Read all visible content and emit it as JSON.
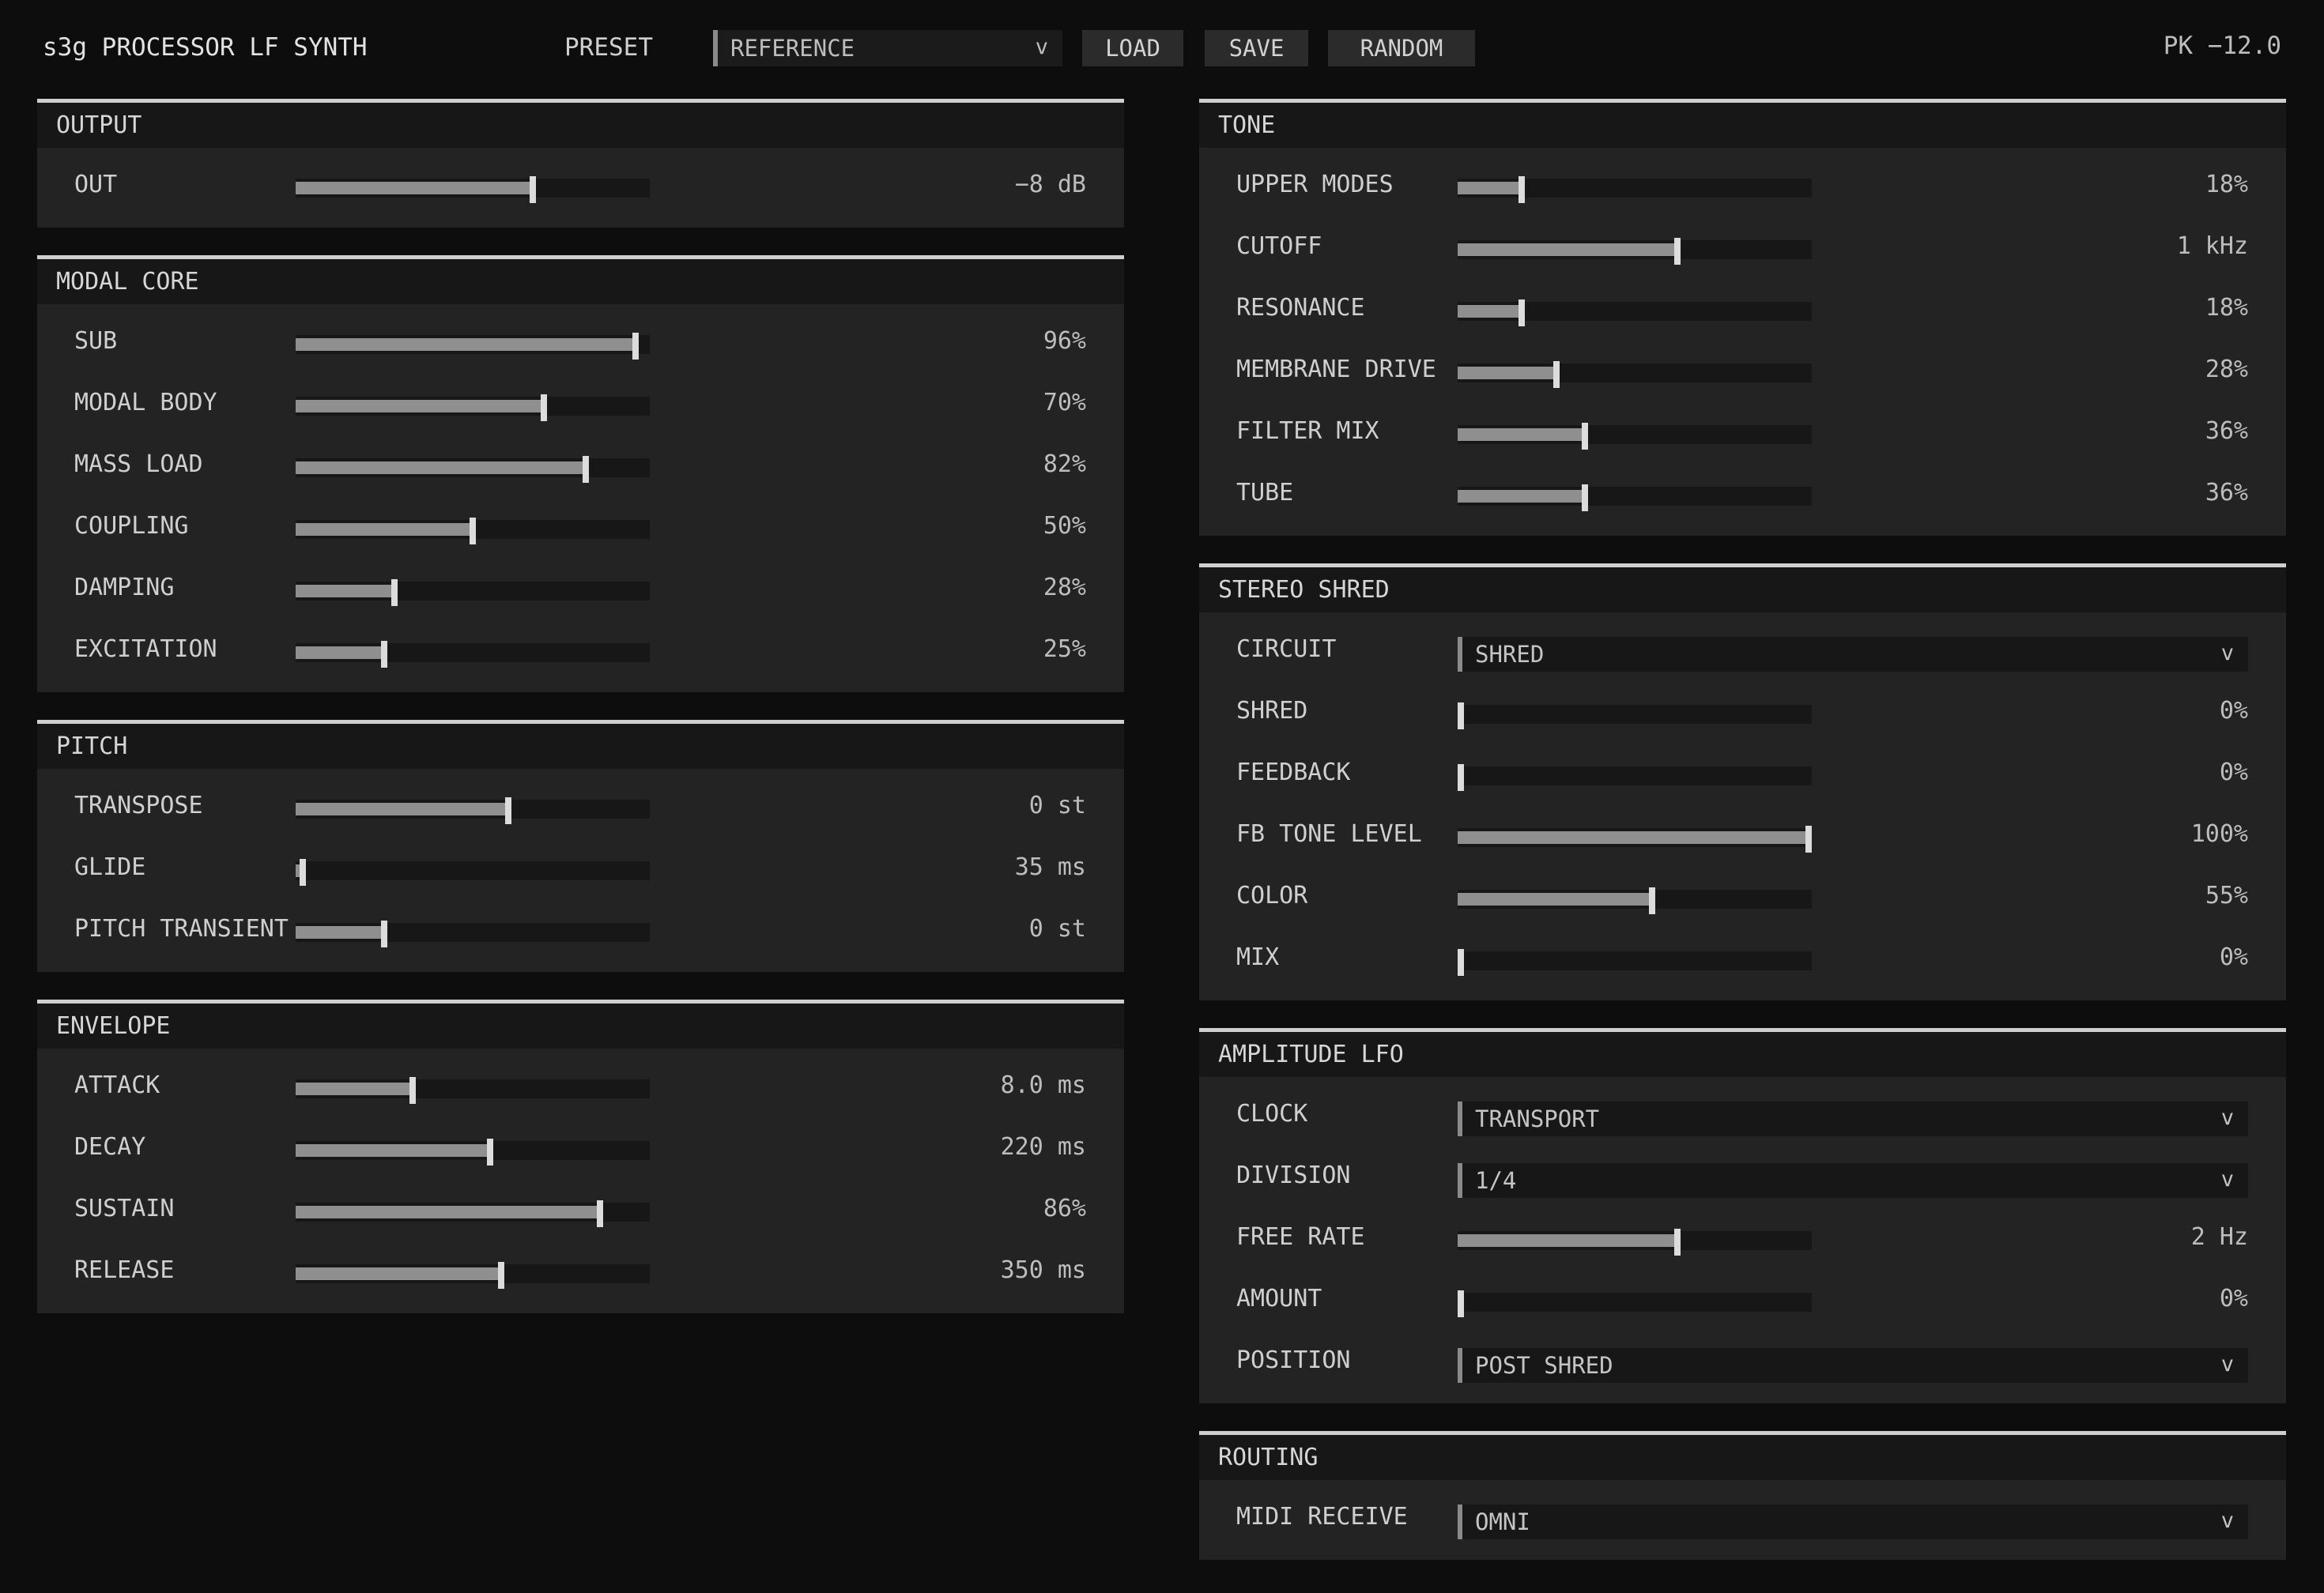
{
  "header": {
    "title": "s3g PROCESSOR LF SYNTH",
    "preset_label": "PRESET",
    "preset_value": "REFERENCE",
    "load": "LOAD",
    "save": "SAVE",
    "random": "RANDOM",
    "peak": "PK −12.0"
  },
  "output": {
    "title": "OUTPUT",
    "rows": [
      {
        "label": "OUT",
        "value": "−8 dB",
        "level": 0.67
      }
    ]
  },
  "modal_core": {
    "title": "MODAL CORE",
    "rows": [
      {
        "label": "SUB",
        "value": "96%",
        "level": 0.96
      },
      {
        "label": "MODAL BODY",
        "value": "70%",
        "level": 0.7
      },
      {
        "label": "MASS LOAD",
        "value": "82%",
        "level": 0.82
      },
      {
        "label": "COUPLING",
        "value": "50%",
        "level": 0.5
      },
      {
        "label": "DAMPING",
        "value": "28%",
        "level": 0.28
      },
      {
        "label": "EXCITATION",
        "value": "25%",
        "level": 0.25
      }
    ]
  },
  "pitch": {
    "title": "PITCH",
    "rows": [
      {
        "label": "TRANSPOSE",
        "value": "0 st",
        "level": 0.6
      },
      {
        "label": "GLIDE",
        "value": "35 ms",
        "level": 0.02
      },
      {
        "label": "PITCH TRANSIENT",
        "value": "0 st",
        "level": 0.25
      }
    ]
  },
  "envelope": {
    "title": "ENVELOPE",
    "rows": [
      {
        "label": "ATTACK",
        "value": "8.0 ms",
        "level": 0.33
      },
      {
        "label": "DECAY",
        "value": "220 ms",
        "level": 0.55
      },
      {
        "label": "SUSTAIN",
        "value": "86%",
        "level": 0.86
      },
      {
        "label": "RELEASE",
        "value": "350 ms",
        "level": 0.58
      }
    ]
  },
  "tone": {
    "title": "TONE",
    "rows": [
      {
        "label": "UPPER MODES",
        "value": "18%",
        "level": 0.18
      },
      {
        "label": "CUTOFF",
        "value": "1 kHz",
        "level": 0.62
      },
      {
        "label": "RESONANCE",
        "value": "18%",
        "level": 0.18
      },
      {
        "label": "MEMBRANE DRIVE",
        "value": "28%",
        "level": 0.28
      },
      {
        "label": "FILTER MIX",
        "value": "36%",
        "level": 0.36
      },
      {
        "label": "TUBE",
        "value": "36%",
        "level": 0.36
      }
    ]
  },
  "stereo_shred": {
    "title": "STEREO SHRED",
    "circuit_label": "CIRCUIT",
    "circuit_value": "SHRED",
    "rows": [
      {
        "label": "SHRED",
        "value": "0%",
        "level": 0.0
      },
      {
        "label": "FEEDBACK",
        "value": "0%",
        "level": 0.0
      },
      {
        "label": "FB TONE LEVEL",
        "value": "100%",
        "level": 1.0
      },
      {
        "label": "COLOR",
        "value": "55%",
        "level": 0.55
      },
      {
        "label": "MIX",
        "value": "0%",
        "level": 0.0
      }
    ]
  },
  "amp_lfo": {
    "title": "AMPLITUDE LFO",
    "clock_label": "CLOCK",
    "clock_value": "TRANSPORT",
    "division_label": "DIVISION",
    "division_value": "1/4",
    "free_rate": {
      "label": "FREE RATE",
      "value": "2 Hz",
      "level": 0.62
    },
    "amount": {
      "label": "AMOUNT",
      "value": "0%",
      "level": 0.0
    },
    "position_label": "POSITION",
    "position_value": "POST SHRED"
  },
  "routing": {
    "title": "ROUTING",
    "midi_label": "MIDI RECEIVE",
    "midi_value": "OMNI"
  },
  "icons": {
    "chevron": "v"
  }
}
